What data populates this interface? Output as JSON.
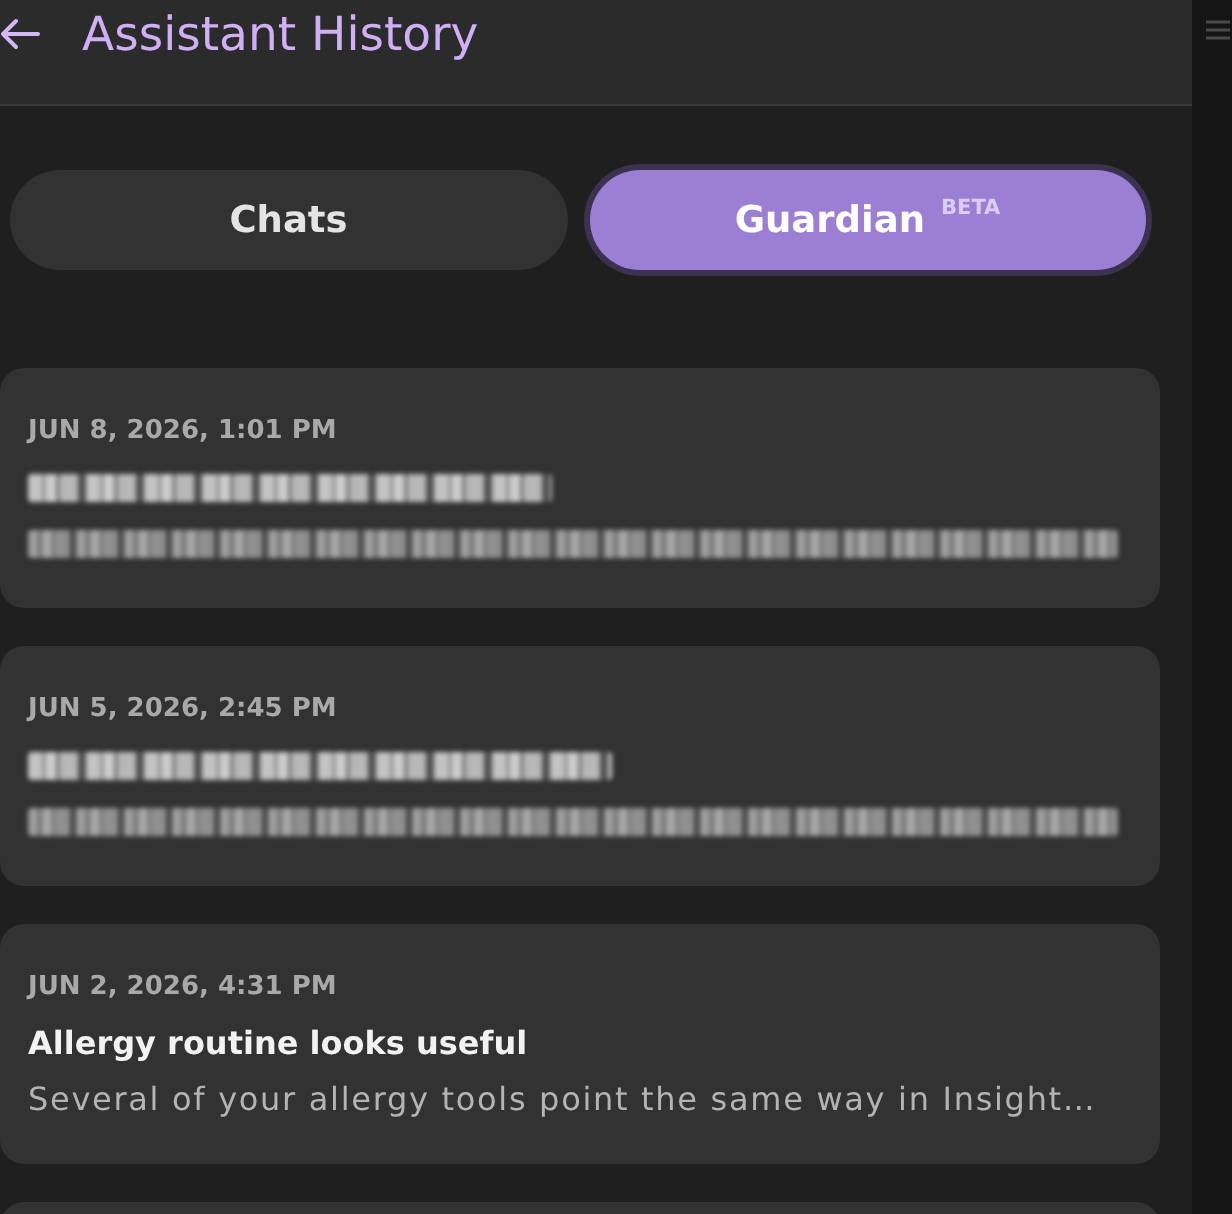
{
  "header": {
    "title": "Assistant History"
  },
  "tabs": [
    {
      "label": "Chats",
      "selected": false
    },
    {
      "label": "Guardian",
      "badge": "BETA",
      "selected": true
    }
  ],
  "history": [
    {
      "date": "JUN 8, 2026, 1:01 PM",
      "blurred": true
    },
    {
      "date": "JUN 5, 2026, 2:45 PM",
      "blurred": true
    },
    {
      "date": "JUN 2, 2026, 4:31 PM",
      "blurred": false,
      "title": "Allergy routine looks useful",
      "preview": "Several of your allergy tools point the same way in Insight…"
    }
  ]
}
